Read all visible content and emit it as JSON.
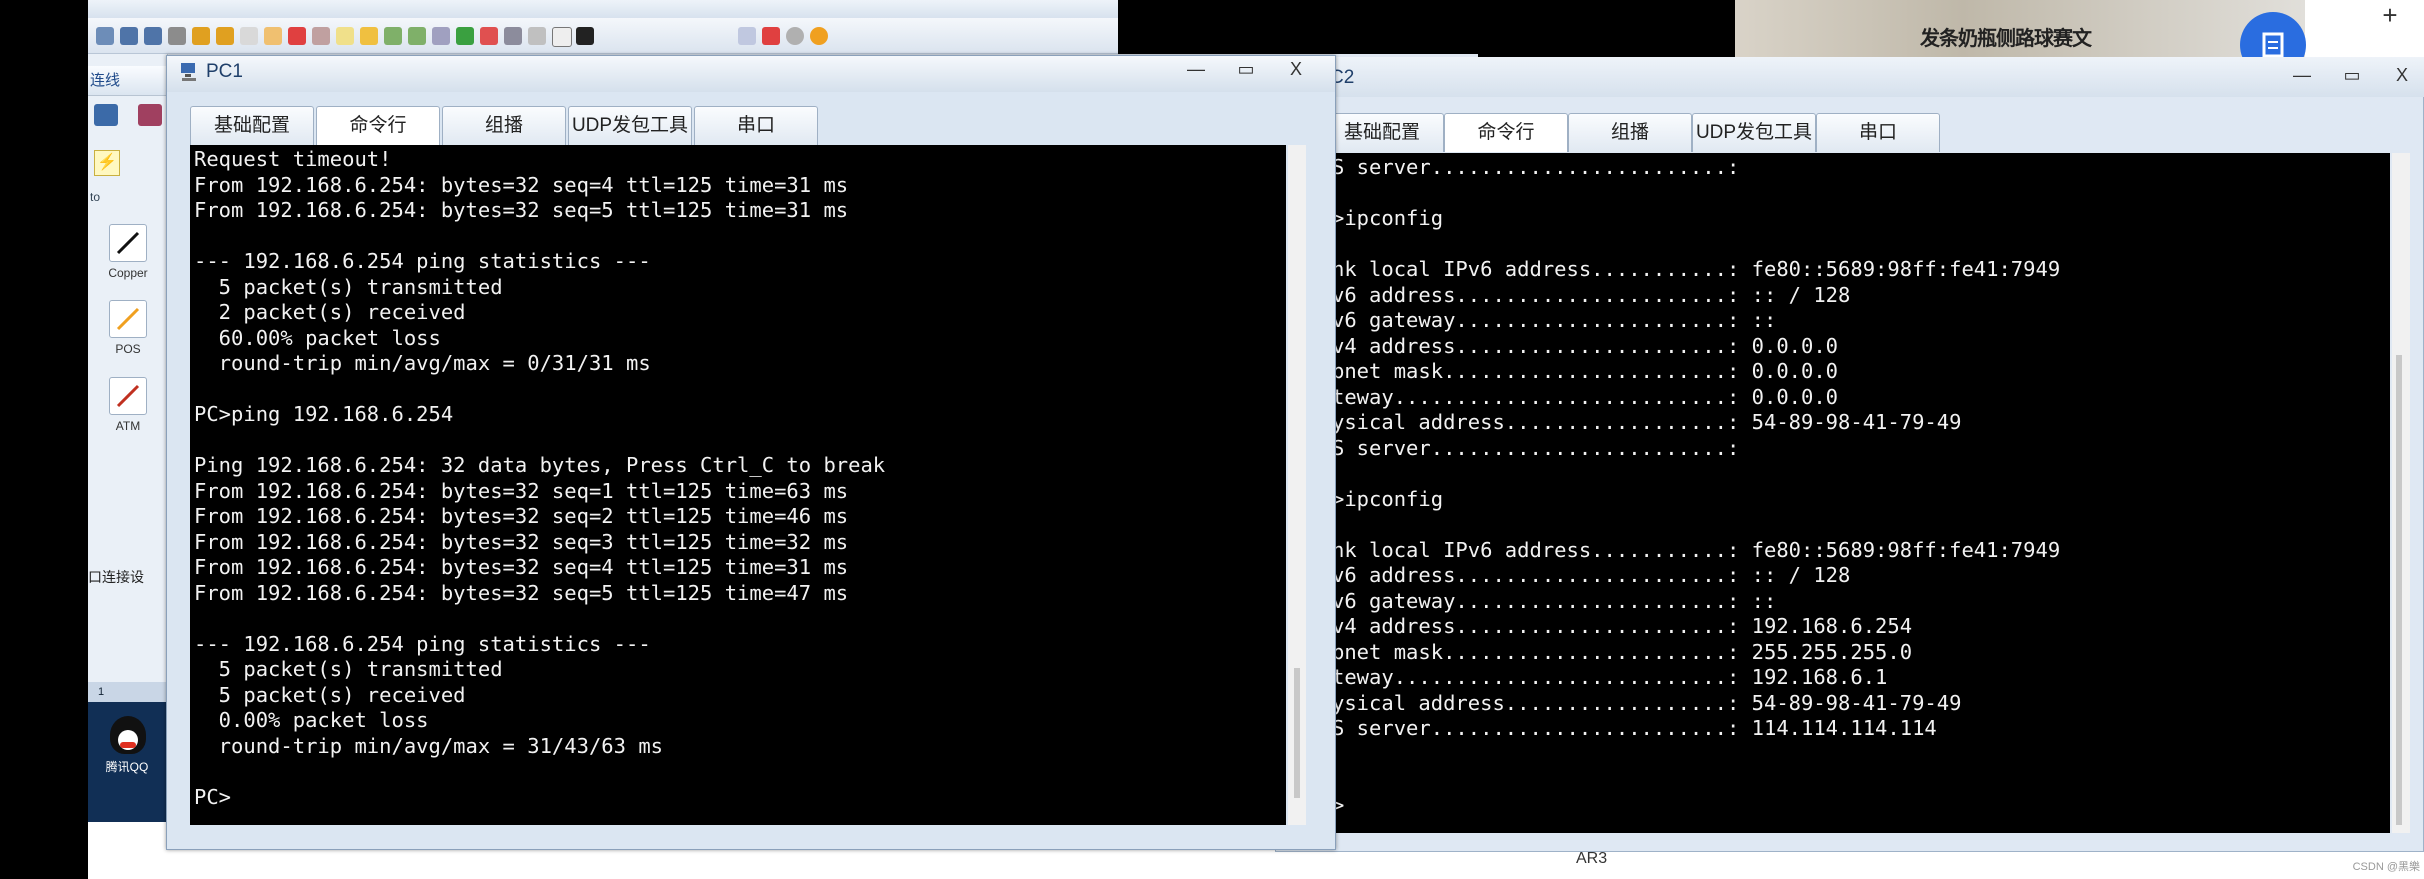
{
  "main_app": {
    "title": "",
    "left_panel_header": "连线",
    "palette": [
      {
        "label": "Copper",
        "icon": "copper-cable-icon"
      },
      {
        "label": "POS",
        "icon": "pos-cable-icon"
      },
      {
        "label": "ATM",
        "icon": "atm-cable-icon"
      }
    ],
    "auto_label": "to",
    "port_setting_label": "口连接设",
    "tab_index": "1",
    "qq_label": "腾讯QQ",
    "device_label": "AR3",
    "watermark": "CSDN @黑樂"
  },
  "video": {
    "caption": "发条奶瓶侧路球赛文",
    "plus": "+"
  },
  "pc1": {
    "title": "PC1",
    "tabs": [
      "基础配置",
      "命令行",
      "组播",
      "UDP发包工具",
      "串口"
    ],
    "active_tab": 1,
    "window_buttons": {
      "minimize": "—",
      "maximize": "▭",
      "close": "X"
    },
    "terminal_lines": [
      "Request timeout!",
      "From 192.168.6.254: bytes=32 seq=4 ttl=125 time=31 ms",
      "From 192.168.6.254: bytes=32 seq=5 ttl=125 time=31 ms",
      "",
      "--- 192.168.6.254 ping statistics ---",
      "  5 packet(s) transmitted",
      "  2 packet(s) received",
      "  60.00% packet loss",
      "  round-trip min/avg/max = 0/31/31 ms",
      "",
      "PC>ping 192.168.6.254",
      "",
      "Ping 192.168.6.254: 32 data bytes, Press Ctrl_C to break",
      "From 192.168.6.254: bytes=32 seq=1 ttl=125 time=63 ms",
      "From 192.168.6.254: bytes=32 seq=2 ttl=125 time=46 ms",
      "From 192.168.6.254: bytes=32 seq=3 ttl=125 time=32 ms",
      "From 192.168.6.254: bytes=32 seq=4 ttl=125 time=31 ms",
      "From 192.168.6.254: bytes=32 seq=5 ttl=125 time=47 ms",
      "",
      "--- 192.168.6.254 ping statistics ---",
      "  5 packet(s) transmitted",
      "  5 packet(s) received",
      "  0.00% packet loss",
      "  round-trip min/avg/max = 31/43/63 ms",
      "",
      "PC>"
    ]
  },
  "pc2": {
    "title": "C2",
    "tabs": [
      "基础配置",
      "命令行",
      "组播",
      "UDP发包工具",
      "串口"
    ],
    "active_tab": 1,
    "window_buttons": {
      "minimize": "—",
      "maximize": "▭",
      "close": "X"
    },
    "terminal_lines": [
      "S server........................:",
      "",
      ">ipconfig",
      "",
      "nk local IPv6 address...........: fe80::5689:98ff:fe41:7949",
      "v6 address......................: :: / 128",
      "v6 gateway......................: ::",
      "v4 address......................: 0.0.0.0",
      "bnet mask.......................: 0.0.0.0",
      "teway...........................: 0.0.0.0",
      "ysical address..................: 54-89-98-41-79-49",
      "S server........................:",
      "",
      ">ipconfig",
      "",
      "nk local IPv6 address...........: fe80::5689:98ff:fe41:7949",
      "v6 address......................: :: / 128",
      "v6 gateway......................: ::",
      "v4 address......................: 192.168.6.254",
      "bnet mask.......................: 255.255.255.0",
      "teway...........................: 192.168.6.1",
      "ysical address..................: 54-89-98-41-79-49",
      "S server........................: 114.114.114.114",
      "",
      "",
      ">"
    ]
  },
  "colors": {
    "terminal_bg": "#000000",
    "terminal_fg": "#f2f2f2",
    "window_chrome": "#dbe6f2"
  }
}
